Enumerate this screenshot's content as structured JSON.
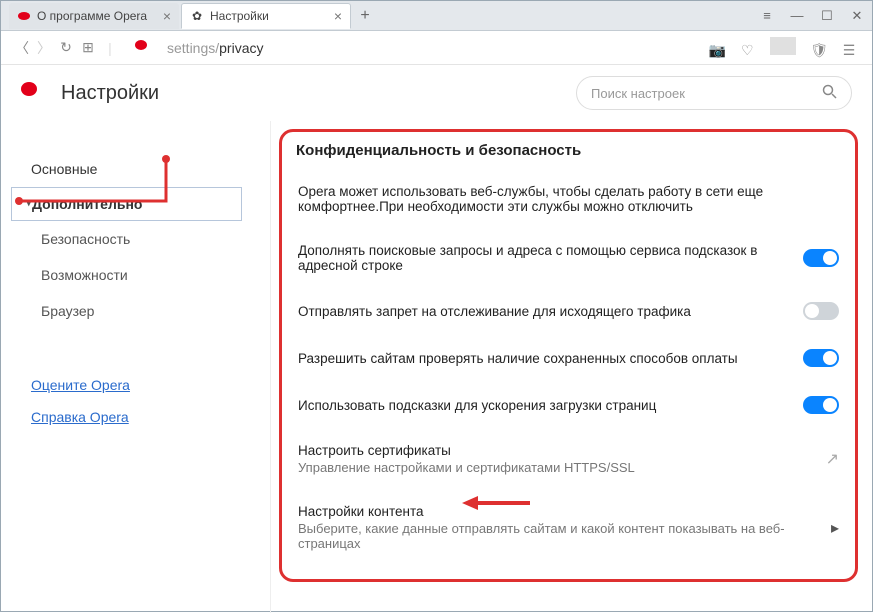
{
  "tabs": [
    {
      "label": "О программе Opera"
    },
    {
      "label": "Настройки"
    }
  ],
  "address": {
    "prefix": "settings/",
    "path": "privacy"
  },
  "header": {
    "title": "Настройки"
  },
  "search": {
    "placeholder": "Поиск настроек"
  },
  "sidebar": {
    "basic": "Основные",
    "advanced": "Дополнительно",
    "security": "Безопасность",
    "features": "Возможности",
    "browser": "Браузер",
    "rate": "Оцените Opera",
    "help": "Справка Opera"
  },
  "panel": {
    "title": "Конфиденциальность и безопасность",
    "intro": "Opera может использовать веб-службы, чтобы сделать работу в сети еще комфортнее.При необходимости эти службы можно отключить",
    "rows": {
      "suggest": "Дополнять поисковые запросы и адреса с помощью сервиса подсказок в адресной строке",
      "dnt": "Отправлять запрет на отслеживание для исходящего трафика",
      "payments": "Разрешить сайтам проверять наличие сохраненных способов оплаты",
      "preload": "Использовать подсказки для ускорения загрузки страниц",
      "certs": {
        "title": "Настроить сертификаты",
        "sub": "Управление настройками и сертификатами HTTPS/SSL"
      },
      "content": {
        "title": "Настройки контента",
        "sub": "Выберите, какие данные отправлять сайтам и какой контент показывать на веб-страницах"
      }
    }
  }
}
